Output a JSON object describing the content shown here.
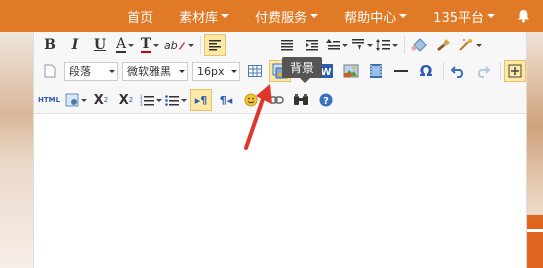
{
  "nav": {
    "items": [
      {
        "label": "首页",
        "dropdown": false
      },
      {
        "label": "素材库",
        "dropdown": true
      },
      {
        "label": "付费服务",
        "dropdown": true
      },
      {
        "label": "帮助中心",
        "dropdown": true
      },
      {
        "label": "135平台",
        "dropdown": true
      }
    ],
    "bell_icon": "bell-icon"
  },
  "toolbar": {
    "row1": {
      "bold": "B",
      "italic": "I",
      "underline": "U",
      "font_color": "A",
      "bg_color": "T",
      "superscript_style": "ab"
    },
    "row2": {
      "paragraph_select": "段落",
      "font_select": "微软雅黑",
      "size_select": "16px"
    },
    "row3": {
      "html_label": "HTML",
      "sup": "X",
      "sup_mark": "2",
      "sub": "X",
      "sub_mark": "2"
    },
    "tooltip": "背景"
  },
  "colors": {
    "nav_bg": "#e07a26",
    "accent_arrow": "#e0352b",
    "active_bg": "#fde8a5"
  }
}
